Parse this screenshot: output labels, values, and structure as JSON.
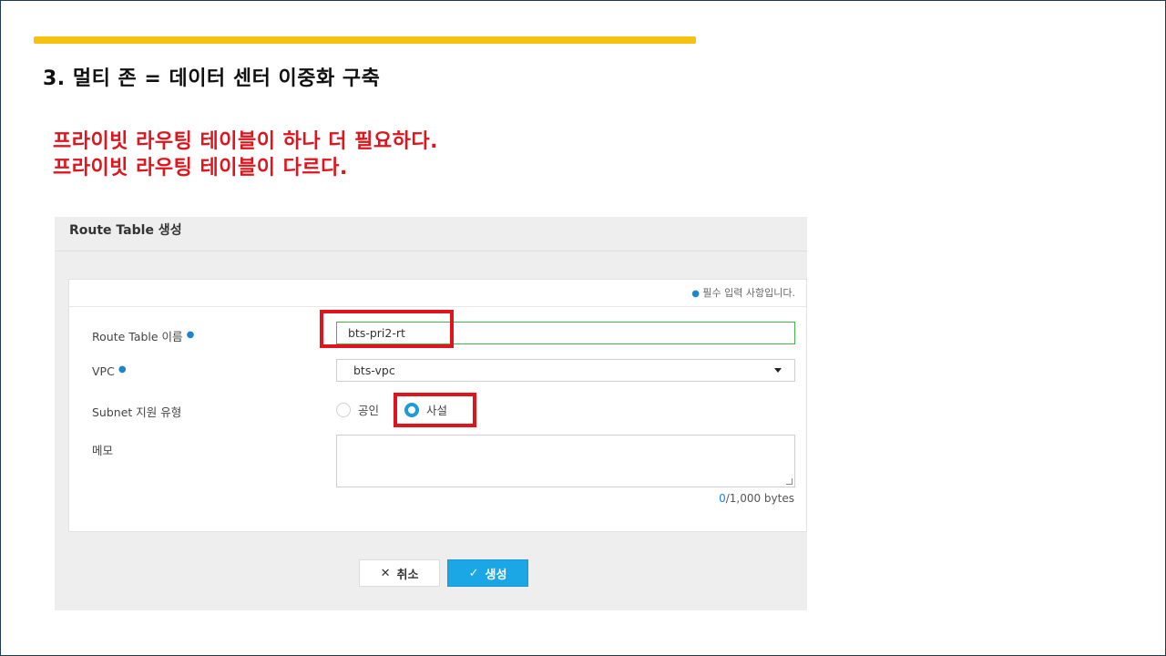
{
  "slide": {
    "title": "3. 멀티 존 = 데이터 센터 이중화 구축",
    "notes": [
      "프라이빗 라우팅 테이블이 하나 더 필요하다.",
      "프라이빗 라우팅 테이블이 다르다."
    ]
  },
  "panel": {
    "title": "Route Table 생성",
    "required_notice": "필수 입력 사항입니다.",
    "fields": {
      "name_label": "Route Table 이름",
      "name_value": "bts-pri2-rt",
      "vpc_label": "VPC",
      "vpc_value": "bts-vpc",
      "subnet_label": "Subnet 지원 유형",
      "subnet_options": [
        "공인",
        "사설"
      ],
      "subnet_selected": "사설",
      "memo_label": "메모",
      "memo_value": "",
      "memo_count": "0",
      "memo_limit": "/1,000 bytes"
    },
    "buttons": {
      "cancel": "취소",
      "create": "생성"
    }
  },
  "colors": {
    "accent_bar": "#f6c20f",
    "note_text": "#e0141c",
    "highlight_box": "#e0141c",
    "primary_button": "#1ba7e6",
    "required_dot": "#1e86c8",
    "valid_input_border": "#43b649"
  },
  "icons": {
    "required": "dot-icon",
    "dropdown": "caret-down-icon",
    "cancel": "close-icon",
    "create": "check-icon"
  }
}
